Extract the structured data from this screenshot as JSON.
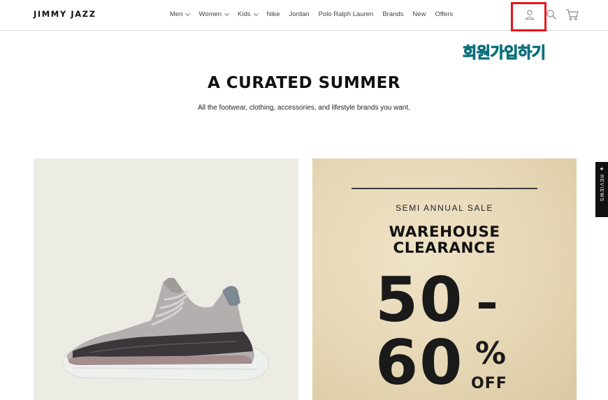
{
  "header": {
    "logo": "JIMMY JAZZ",
    "nav": [
      {
        "label": "Men",
        "has_dropdown": true
      },
      {
        "label": "Women",
        "has_dropdown": true
      },
      {
        "label": "Kids",
        "has_dropdown": true
      },
      {
        "label": "Nike",
        "has_dropdown": false
      },
      {
        "label": "Jordan",
        "has_dropdown": false
      },
      {
        "label": "Polo Ralph Lauren",
        "has_dropdown": false
      },
      {
        "label": "Brands",
        "has_dropdown": false
      },
      {
        "label": "New",
        "has_dropdown": false
      },
      {
        "label": "Offers",
        "has_dropdown": false
      }
    ],
    "icons": [
      "account-icon",
      "search-icon",
      "cart-icon"
    ]
  },
  "annotation": {
    "label": "회원가입하기",
    "highlight_color": "#e8131b",
    "text_color": "#27b6c4"
  },
  "hero": {
    "title": "A CURATED SUMMER",
    "subtitle": "All the footwear, clothing, accessories, and lifestyle brands you want."
  },
  "sale_card": {
    "kicker": "SEMI ANNUAL SALE",
    "title_line1": "WAREHOUSE",
    "title_line2": "CLEARANCE",
    "range_top": "50",
    "range_bottom": "60",
    "percent": "%",
    "off": "OFF"
  },
  "reviews_tab": {
    "label": "★ REVIEWS"
  },
  "colors": {
    "accent": "#111111",
    "card_left_bg": "#ecebe4",
    "card_right_bg": "#e6d7b5"
  }
}
